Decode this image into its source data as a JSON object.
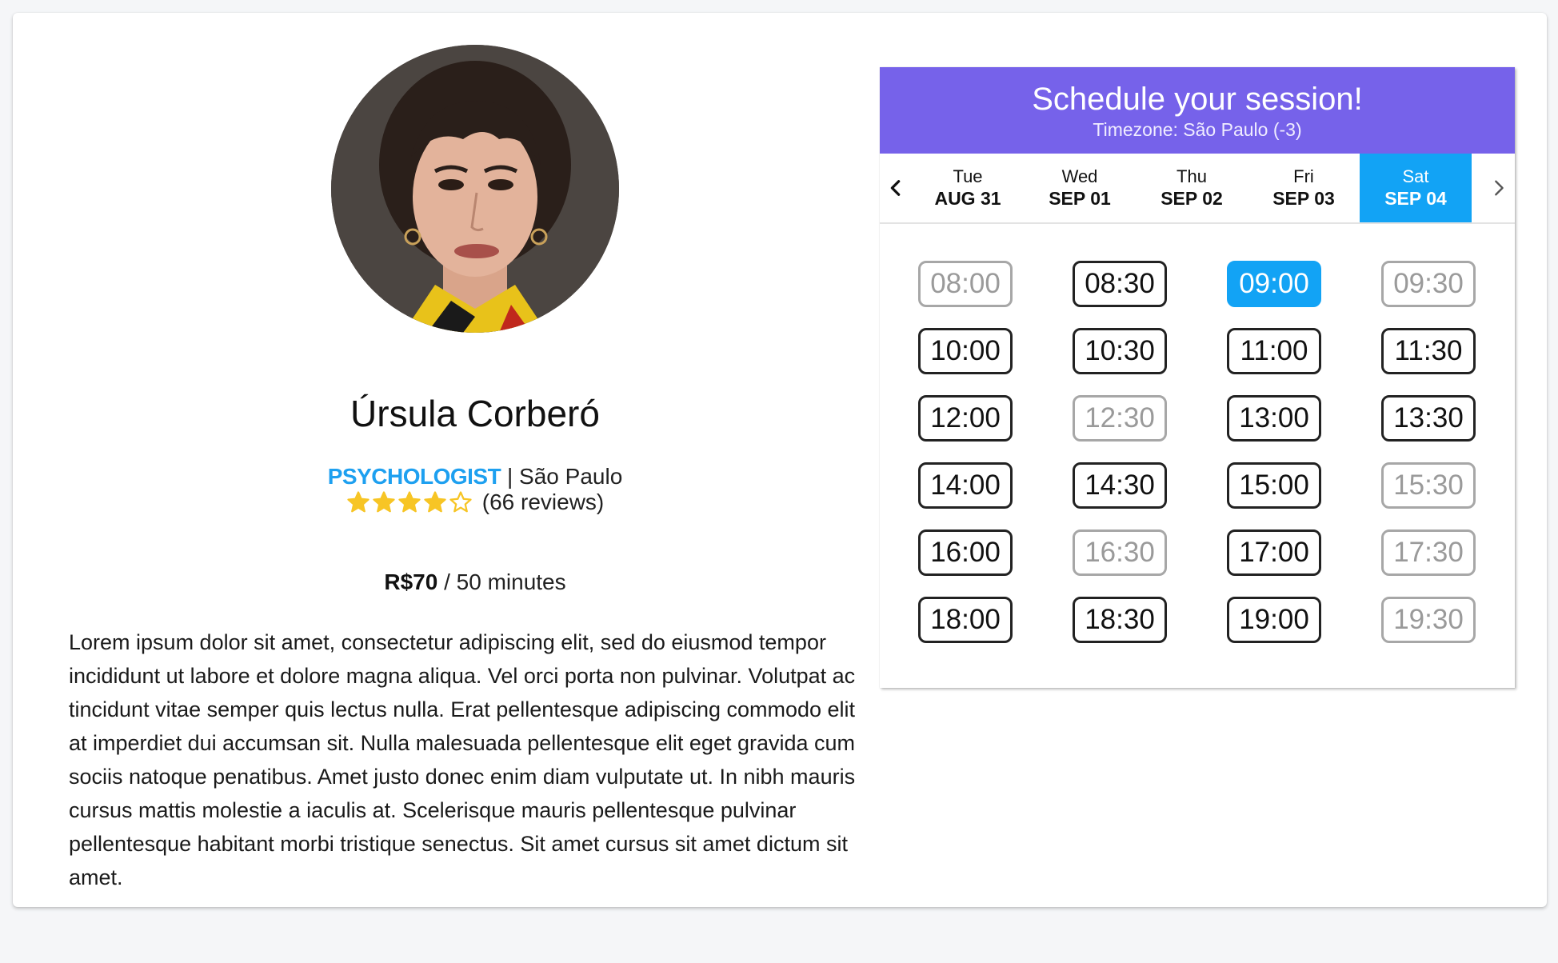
{
  "profile": {
    "name": "Úrsula Corberó",
    "profession": "PSYCHOLOGIST",
    "separator": "|",
    "city": "São Paulo",
    "rating": 4,
    "rating_max": 5,
    "reviews": "(66 reviews)",
    "price": "R$70",
    "duration": "/ 50 minutes",
    "bio": "Lorem ipsum dolor sit amet, consectetur adipiscing elit, sed do eiusmod tempor incididunt ut labore et dolore magna aliqua. Vel orci porta non pulvinar. Volutpat ac tincidunt vitae semper quis lectus nulla. Erat pellentesque adipiscing commodo elit at imperdiet dui accumsan sit. Nulla malesuada pellentesque elit eget gravida cum sociis natoque penatibus. Amet justo donec enim diam vulputate ut. In nibh mauris cursus mattis molestie a iaculis at. Scelerisque mauris pellentesque pulvinar pellentesque habitant morbi tristique senectus. Sit amet cursus sit amet dictum sit amet."
  },
  "scheduler": {
    "title": "Schedule your session!",
    "timezone": "Timezone: São Paulo (-3)",
    "prev_icon": "chevron-left-icon",
    "next_icon": "chevron-right-icon",
    "days": [
      {
        "dow": "Tue",
        "date": "AUG 31",
        "active": false
      },
      {
        "dow": "Wed",
        "date": "SEP 01",
        "active": false
      },
      {
        "dow": "Thu",
        "date": "SEP 02",
        "active": false
      },
      {
        "dow": "Fri",
        "date": "SEP 03",
        "active": false
      },
      {
        "dow": "Sat",
        "date": "SEP 04",
        "active": true
      }
    ],
    "slots": [
      {
        "time": "08:00",
        "state": "unavailable"
      },
      {
        "time": "08:30",
        "state": "available"
      },
      {
        "time": "09:00",
        "state": "selected"
      },
      {
        "time": "09:30",
        "state": "unavailable"
      },
      {
        "time": "10:00",
        "state": "available"
      },
      {
        "time": "10:30",
        "state": "available"
      },
      {
        "time": "11:00",
        "state": "available"
      },
      {
        "time": "11:30",
        "state": "available"
      },
      {
        "time": "12:00",
        "state": "available"
      },
      {
        "time": "12:30",
        "state": "unavailable"
      },
      {
        "time": "13:00",
        "state": "available"
      },
      {
        "time": "13:30",
        "state": "available"
      },
      {
        "time": "14:00",
        "state": "available"
      },
      {
        "time": "14:30",
        "state": "available"
      },
      {
        "time": "15:00",
        "state": "available"
      },
      {
        "time": "15:30",
        "state": "unavailable"
      },
      {
        "time": "16:00",
        "state": "available"
      },
      {
        "time": "16:30",
        "state": "unavailable"
      },
      {
        "time": "17:00",
        "state": "available"
      },
      {
        "time": "17:30",
        "state": "unavailable"
      },
      {
        "time": "18:00",
        "state": "available"
      },
      {
        "time": "18:30",
        "state": "available"
      },
      {
        "time": "19:00",
        "state": "available"
      },
      {
        "time": "19:30",
        "state": "unavailable"
      }
    ]
  },
  "colors": {
    "header_bg": "#7662ea",
    "accent_blue": "#12a3f5",
    "profession_blue": "#1ea0f0",
    "star_gold": "#f7c525"
  }
}
